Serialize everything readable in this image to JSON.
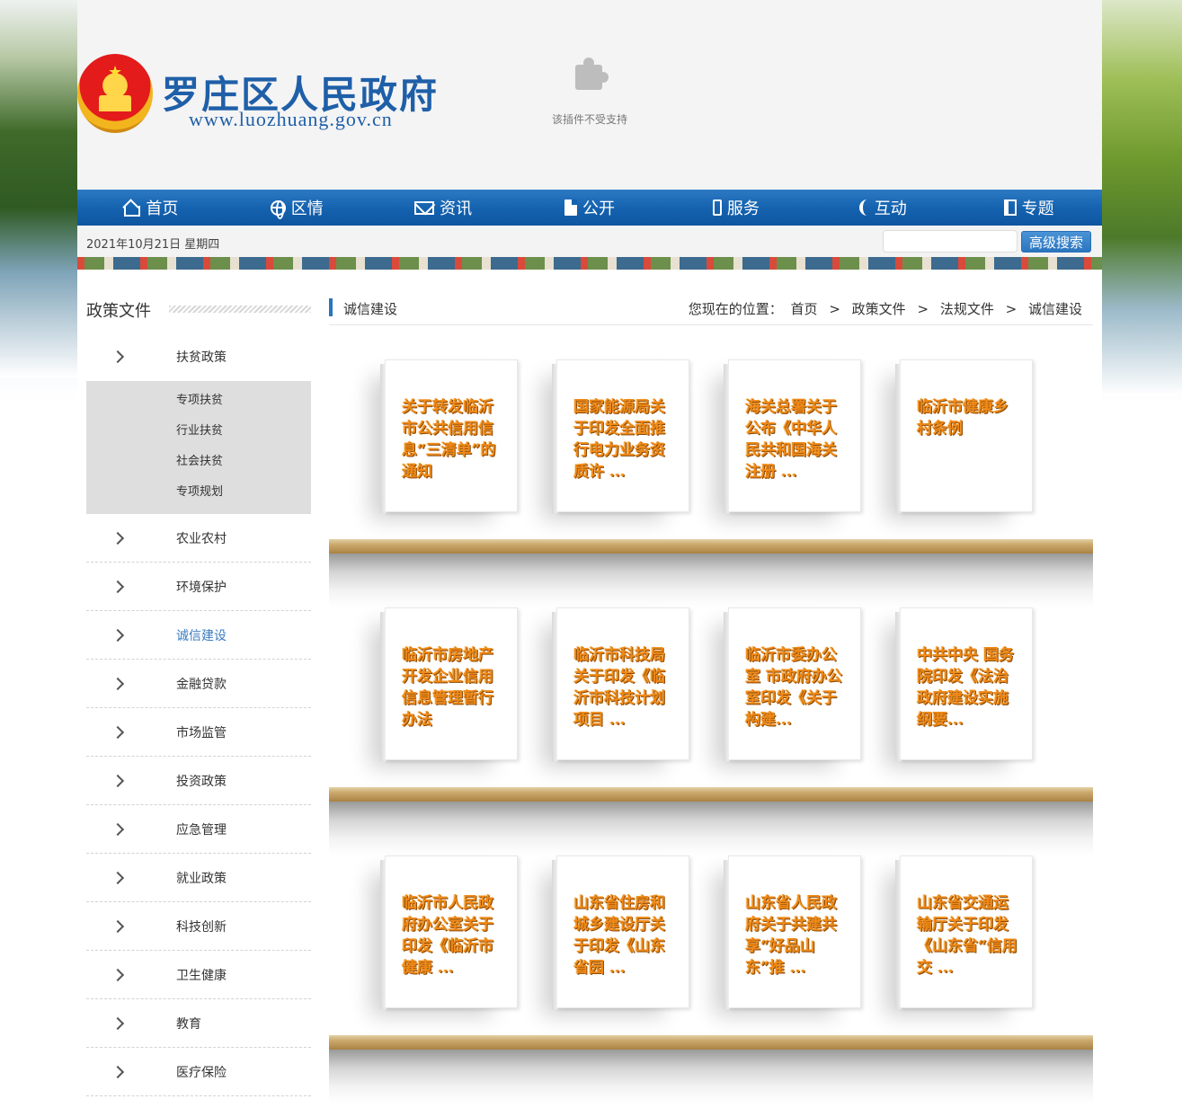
{
  "header": {
    "site_title": "罗庄区人民政府",
    "site_url": "www.luozhuang.gov.cn",
    "plugin_message": "该插件不受支持"
  },
  "nav": {
    "items": [
      {
        "label": "首页",
        "icon": "home-icon"
      },
      {
        "label": "区情",
        "icon": "globe-icon"
      },
      {
        "label": "资讯",
        "icon": "mail-icon"
      },
      {
        "label": "公开",
        "icon": "document-icon"
      },
      {
        "label": "服务",
        "icon": "phone-icon"
      },
      {
        "label": "互动",
        "icon": "handset-icon"
      },
      {
        "label": "专题",
        "icon": "book-icon"
      }
    ]
  },
  "datebar": {
    "date": "2021年10月21日 星期四",
    "search_placeholder": "",
    "search_button": "高级搜索"
  },
  "sidebar": {
    "title": "政策文件",
    "first": {
      "label": "扶贫政策"
    },
    "sub_items": [
      "专项扶贫",
      "行业扶贫",
      "社会扶贫",
      "专项规划"
    ],
    "items": [
      {
        "label": "农业农村"
      },
      {
        "label": "环境保护"
      },
      {
        "label": "诚信建设",
        "active": true
      },
      {
        "label": "金融贷款"
      },
      {
        "label": "市场监管"
      },
      {
        "label": "投资政策"
      },
      {
        "label": "应急管理"
      },
      {
        "label": "就业政策"
      },
      {
        "label": "科技创新"
      },
      {
        "label": "卫生健康"
      },
      {
        "label": "教育"
      },
      {
        "label": "医疗保险"
      }
    ]
  },
  "main": {
    "title": "诚信建设",
    "breadcrumb": {
      "prefix": "您现在的位置：",
      "items": [
        "首页",
        "政策文件",
        "法规文件",
        "诚信建设"
      ],
      "separator": ">"
    },
    "books": [
      [
        "关于转发临沂市公共信用信息“三清单”的通知",
        "国家能源局关于印发全面推行电力业务资质许 ...",
        "海关总署关于公布《中华人民共和国海关注册 ...",
        "临沂市健康乡村条例"
      ],
      [
        "临沂市房地产开发企业信用信息管理暂行办法",
        "临沂市科技局关于印发《临沂市科技计划项目 ...",
        "临沂市委办公室 市政府办公室印发《关于构建...",
        "中共中央 国务院印发《法治政府建设实施纲要..."
      ],
      [
        "临沂市人民政府办公室关于印发《临沂市健康 ...",
        "山东省住房和城乡建设厅关于印发《山东省园 ...",
        "山东省人民政府关于共建共享“好品山东”推 ...",
        "山东省交通运输厅关于印发《山东省“信用交 ..."
      ]
    ]
  },
  "colors": {
    "nav_blue": "#1563b0",
    "title_blue": "#1f5fa8",
    "book_title_orange": "#f08a18",
    "active_link": "#3a7cc0"
  }
}
